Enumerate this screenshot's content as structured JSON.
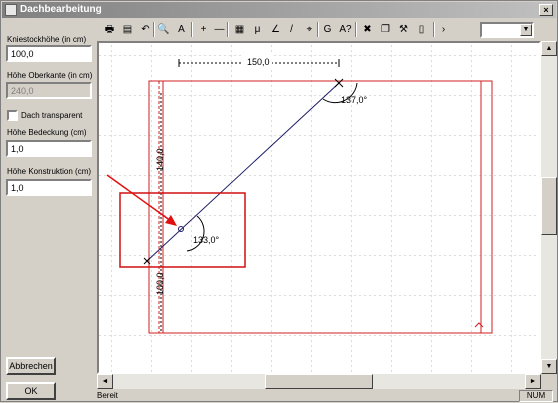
{
  "window": {
    "title": "Dachbearbeitung",
    "close_glyph": "×"
  },
  "form": {
    "kniestock_label": "Kniestockhöhe (in cm)",
    "kniestock_value": "100,0",
    "oberkante_label": "Höhe Oberkante (in cm)",
    "oberkante_value": "240,0",
    "transparent_label": "Dach transparent",
    "bedeckung_label": "Höhe Bedeckung (cm)",
    "bedeckung_value": "1,0",
    "konstruktion_label": "Höhe Konstruktion (cm)",
    "konstruktion_value": "1,0",
    "cancel_label": "Abbrechen",
    "ok_label": "OK"
  },
  "toolbar": {
    "buttons": [
      {
        "icon": "print-icon",
        "glyph": "🖶"
      },
      {
        "icon": "print-preview-icon",
        "glyph": "▤"
      },
      {
        "icon": "undo-icon",
        "glyph": "↶"
      },
      {
        "icon": "zoom-icon",
        "glyph": "🔍"
      },
      {
        "icon": "zoom-text-icon",
        "glyph": "A"
      },
      {
        "icon": "plus-icon",
        "glyph": "+"
      },
      {
        "icon": "minus-icon",
        "glyph": "—"
      },
      {
        "icon": "grid-icon",
        "glyph": "▦"
      },
      {
        "icon": "dimension-icon",
        "glyph": "μ"
      },
      {
        "icon": "angle-icon",
        "glyph": "∠"
      },
      {
        "icon": "line-icon",
        "glyph": "/"
      },
      {
        "icon": "snap-icon",
        "glyph": "⌖"
      },
      {
        "icon": "g-icon",
        "glyph": "G"
      },
      {
        "icon": "text-icon",
        "glyph": "A?"
      },
      {
        "icon": "delete-icon",
        "glyph": "✖"
      },
      {
        "icon": "copy-icon",
        "glyph": "❐"
      },
      {
        "icon": "tool-icon",
        "glyph": "⚒"
      },
      {
        "icon": "page-icon",
        "glyph": "▯"
      },
      {
        "icon": "next-icon",
        "glyph": "›"
      }
    ],
    "combo_arrow": "▼"
  },
  "drawing": {
    "dim_top": "150,0",
    "dim_left_upper": "140,0",
    "dim_left_lower": "100,0",
    "angle_top": "137,0°",
    "angle_bottom": "133,0°"
  },
  "scroll": {
    "up": "▲",
    "down": "▼",
    "left": "◄",
    "right": "►"
  },
  "status": {
    "text": "Bereit",
    "num": "NUM"
  }
}
